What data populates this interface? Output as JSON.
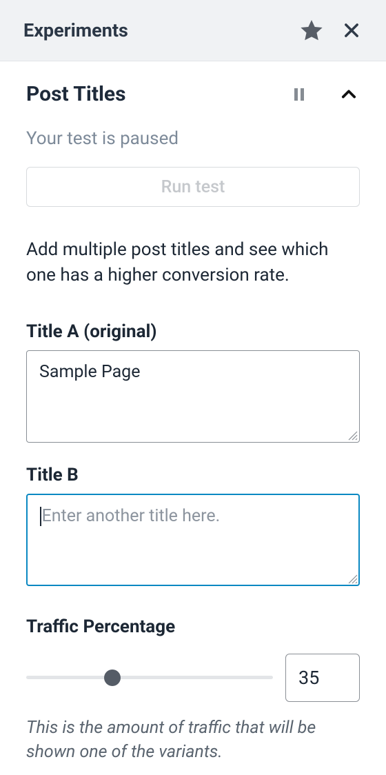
{
  "header": {
    "title": "Experiments"
  },
  "section": {
    "title": "Post Titles",
    "status": "Your test is paused",
    "run_label": "Run test",
    "description": "Add multiple post titles and see which one has a higher conversion rate."
  },
  "fields": {
    "title_a": {
      "label": "Title A (original)",
      "value": "Sample Page"
    },
    "title_b": {
      "label": "Title B",
      "value": "",
      "placeholder": "Enter another title here."
    }
  },
  "traffic": {
    "label": "Traffic Percentage",
    "value": "35",
    "percent": 35,
    "help": "This is the amount of traffic that will be shown one of the variants."
  }
}
